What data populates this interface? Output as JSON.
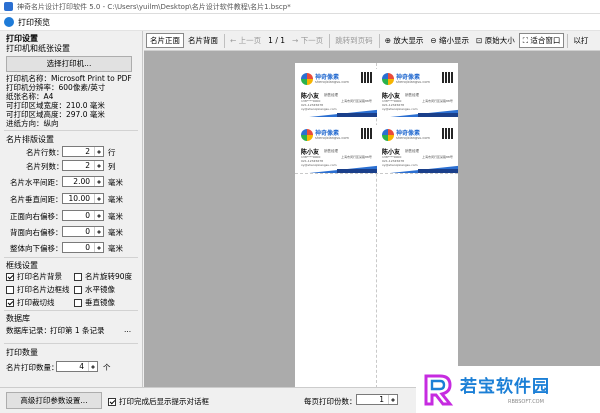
{
  "window": {
    "title": "神奇名片设计打印软件 5.0 - C:\\Users\\yuilm\\Desktop\\名片设计软件教程\\名片1.bscp*"
  },
  "dialog": {
    "title": "打印预览"
  },
  "left": {
    "heading": "打印设置",
    "printer_group": "打印机和纸张设置",
    "select_printer": "选择打印机...",
    "info": [
      "打印机名称：Microsoft Print to PDF",
      "打印机分辨率：600像素/英寸",
      "纸张名称：A4",
      "可打印区域宽度：210.0 毫米",
      "可打印区域高度：297.0 毫米",
      "进纸方向：纵向"
    ],
    "layout_group": "名片排版设置",
    "fields": [
      {
        "label": "名片行数：",
        "value": "2",
        "unit": "行"
      },
      {
        "label": "名片列数：",
        "value": "2",
        "unit": "列"
      },
      {
        "label": "名片水平间距：",
        "value": "2.00",
        "unit": "毫米"
      },
      {
        "label": "名片垂直间距：",
        "value": "10.00",
        "unit": "毫米"
      },
      {
        "label": "正面向右偏移：",
        "value": "0",
        "unit": "毫米"
      },
      {
        "label": "背面向右偏移：",
        "value": "0",
        "unit": "毫米"
      },
      {
        "label": "整体向下偏移：",
        "value": "0",
        "unit": "毫米"
      }
    ],
    "frame_group": "框线设置",
    "checks": [
      {
        "label": "打印名片背景",
        "checked": true
      },
      {
        "label": "名片旋转90度",
        "checked": false
      },
      {
        "label": "打印名片边框线",
        "checked": false
      },
      {
        "label": "水平镜像",
        "checked": false
      },
      {
        "label": "打印裁切线",
        "checked": true
      },
      {
        "label": "垂直镜像",
        "checked": false
      }
    ],
    "db_group": "数据库",
    "db_label": "数据库记录：",
    "db_value": "打印第 1 条记录",
    "db_btn": "...",
    "qty_group": "打印数量",
    "qty_label": "名片打印数量：",
    "qty_value": "4",
    "qty_unit": "个"
  },
  "toolbar": {
    "front": "名片正面",
    "back": "名片背面",
    "prev": "上一页",
    "page": "1 / 1",
    "next": "下一页",
    "jump": "跳转到页码",
    "zoom_in": "放大显示",
    "zoom_out": "缩小显示",
    "original": "原始大小",
    "fit": "适合窗口",
    "print": "以打"
  },
  "card": {
    "brand": "神奇像素",
    "site": "shenqixiangsu.com",
    "name": "陈小友",
    "role": "销售经理",
    "line1": "138****0000",
    "line2": "021-12345678",
    "line3": "xy@shenqixiangsu.com",
    "addr": "上海市闵行区某路88号"
  },
  "bottom": {
    "advanced": "高级打印参数设置...",
    "show_after": "打印完成后显示提示对话框",
    "per_page_label": "每页打印份数：",
    "per_page_value": "1"
  },
  "watermark": {
    "text": "若宝软件园",
    "sub": "RBBSOFT.COM"
  }
}
